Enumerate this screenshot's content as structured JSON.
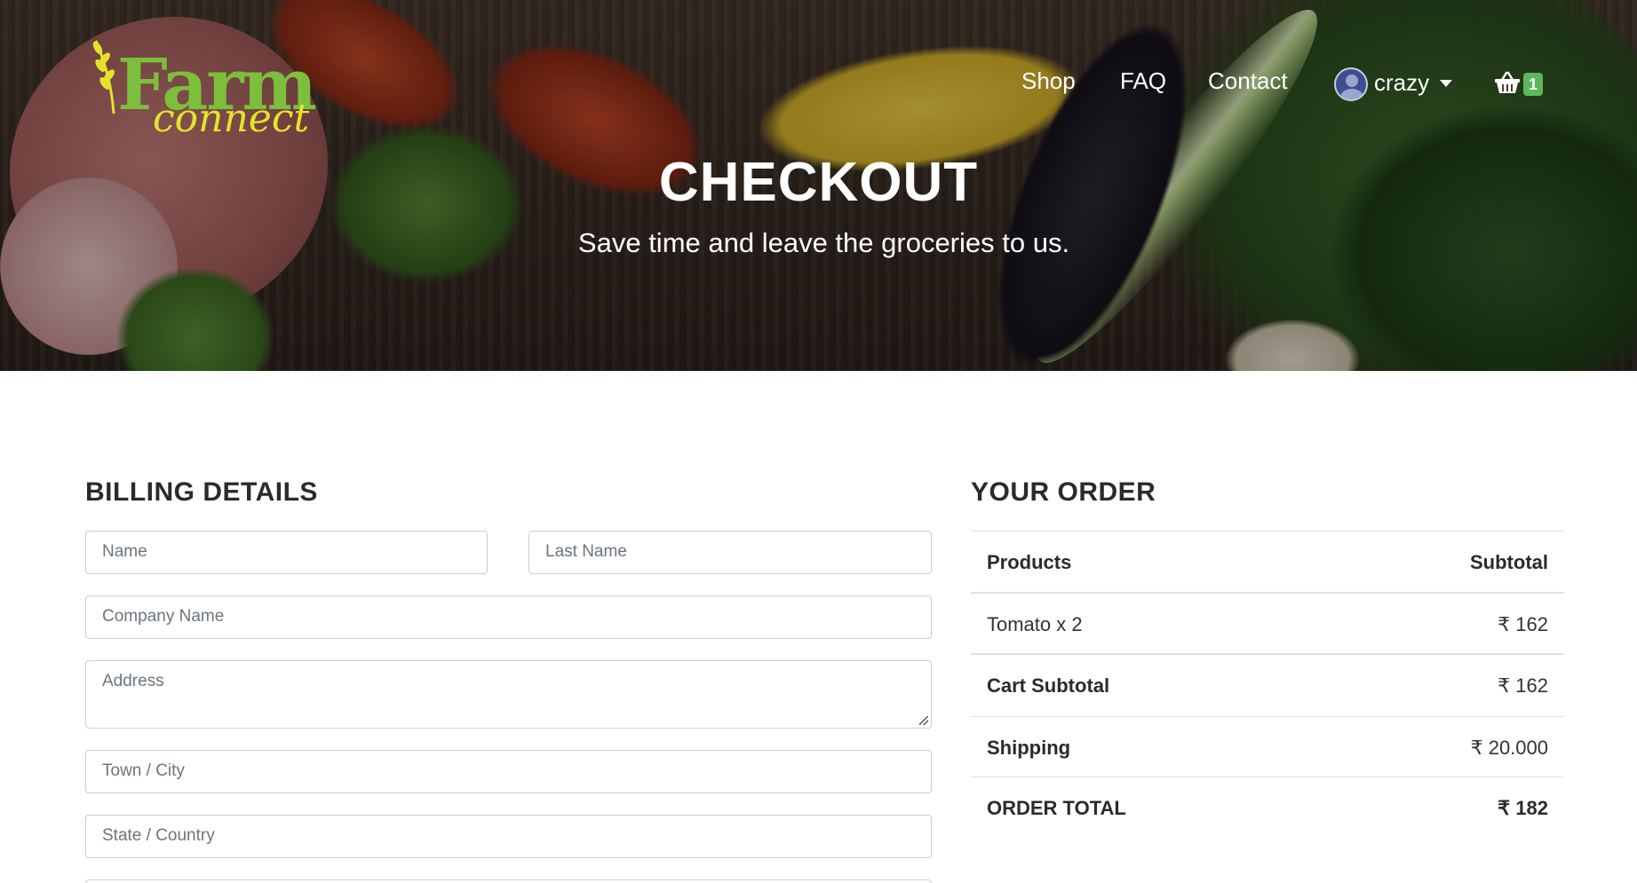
{
  "brand": {
    "logo_main": "Farm",
    "logo_sub": "connect"
  },
  "nav": {
    "shop": "Shop",
    "faq": "FAQ",
    "contact": "Contact",
    "user": "crazy",
    "cart_count": "1"
  },
  "hero": {
    "title": "CHECKOUT",
    "subtitle": "Save time and leave the groceries to us."
  },
  "billing": {
    "title": "BILLING DETAILS",
    "name_placeholder": "Name",
    "last_name_placeholder": "Last Name",
    "company_placeholder": "Company Name",
    "address_placeholder": "Address",
    "town_placeholder": "Town / City",
    "state_placeholder": "State / Country"
  },
  "order": {
    "title": "YOUR ORDER",
    "col_products": "Products",
    "col_subtotal": "Subtotal",
    "items": [
      {
        "name": "Tomato x 2",
        "price": "₹ 162"
      }
    ],
    "cart_subtotal_label": "Cart Subtotal",
    "cart_subtotal_value": "₹ 162",
    "shipping_label": "Shipping",
    "shipping_value": "₹ 20.000",
    "total_label": "ORDER TOTAL",
    "total_value": "₹ 182"
  },
  "colors": {
    "accent": "#5cb85c",
    "logo_green": "#7cbf3d",
    "logo_yellow": "#e3e32a"
  },
  "icons": {
    "user": "user-avatar-icon",
    "dropdown": "caret-down-icon",
    "cart": "shopping-basket-icon"
  }
}
